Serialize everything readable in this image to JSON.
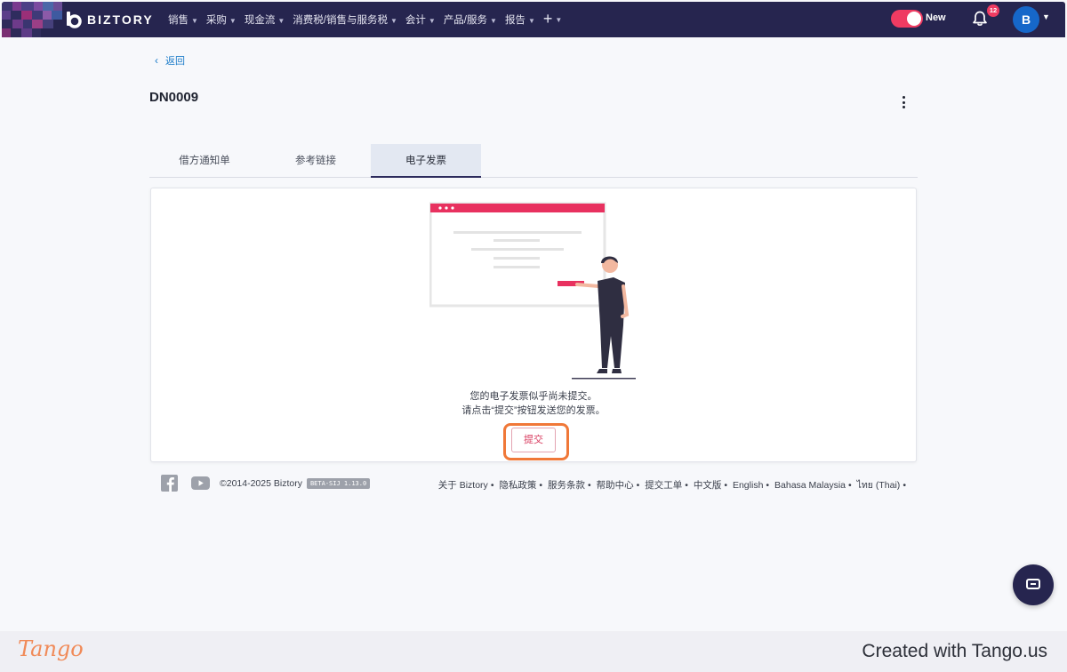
{
  "topbar": {
    "brand": "BIZTORY",
    "nav_items": [
      {
        "label": "销售",
        "icon": "chevron-down-icon"
      },
      {
        "label": "采购",
        "icon": "chevron-down-icon"
      },
      {
        "label": "现金流",
        "icon": "chevron-down-icon"
      },
      {
        "label": "消费税/销售与服务税",
        "icon": "chevron-down-icon"
      },
      {
        "label": "会计",
        "icon": "chevron-down-icon"
      },
      {
        "label": "产品/服务",
        "icon": "chevron-down-icon"
      },
      {
        "label": "报告",
        "icon": "chevron-down-icon"
      }
    ],
    "plus_label": "+",
    "toggle_label": "New",
    "notification_count": "12",
    "avatar_initial": "B"
  },
  "page": {
    "back_label": "返回",
    "title": "DN0009",
    "tabs": [
      {
        "label": "借方通知单",
        "active": false
      },
      {
        "label": "参考链接",
        "active": false
      },
      {
        "label": "电子发票",
        "active": true
      }
    ],
    "message_line1": "您的电子发票似乎尚未提交。",
    "message_line2": "请点击“提交”按钮发送您的发票。",
    "submit_label": "提交"
  },
  "footer": {
    "copyright": "©2014-2025 Biztory",
    "version": "BETA-SIJ 1.13.0",
    "links": [
      "关于 Biztory",
      "隐私政策",
      "服务条款",
      "帮助中心",
      "提交工单",
      "中文版",
      "English",
      "Bahasa Malaysia",
      "ไทย (Thai)"
    ],
    "separator": "•"
  },
  "tango": {
    "logo": "Tango",
    "credit": "Created with Tango.us"
  },
  "colors": {
    "navbar": "#26254f",
    "accent_pink": "#ef3b62",
    "link_blue": "#1c7cc9",
    "highlight_orange": "#f07838",
    "avatar_blue": "#1667c9"
  }
}
